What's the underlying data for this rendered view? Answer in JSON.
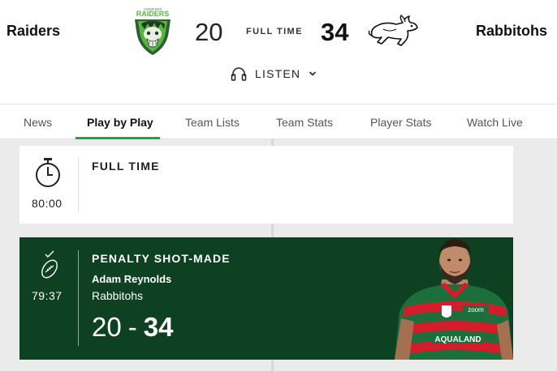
{
  "match": {
    "home_team": "Raiders",
    "away_team": "Rabbitohs",
    "home_score": "20",
    "away_score": "34",
    "status": "FULL TIME",
    "home_logo_text": "RAIDERS",
    "home_logo_subtext": "CANBERRA",
    "listen_label": "LISTEN"
  },
  "tabs": [
    {
      "label": "News",
      "active": false
    },
    {
      "label": "Play by Play",
      "active": true
    },
    {
      "label": "Team Lists",
      "active": false
    },
    {
      "label": "Team Stats",
      "active": false
    },
    {
      "label": "Player Stats",
      "active": false
    },
    {
      "label": "Watch Live",
      "active": false
    }
  ],
  "events": [
    {
      "type": "FULL TIME",
      "time": "80:00",
      "icon": "stopwatch-icon"
    },
    {
      "type": "PENALTY SHOT-MADE",
      "time": "79:37",
      "icon": "football-goal-icon",
      "player": "Adam Reynolds",
      "team": "Rabbitohs",
      "score_home": "20",
      "score_separator": "-",
      "score_away": "34",
      "jersey_text_1": "zoom",
      "jersey_text_2": "AQUALAND"
    }
  ],
  "colors": {
    "accent_green": "#1ca54e",
    "event_card_bg": "#0d4122",
    "raiders_green": "#5bb545",
    "rabbitohs_red": "#d21e2b",
    "rabbitohs_green": "#1a7a3a"
  }
}
